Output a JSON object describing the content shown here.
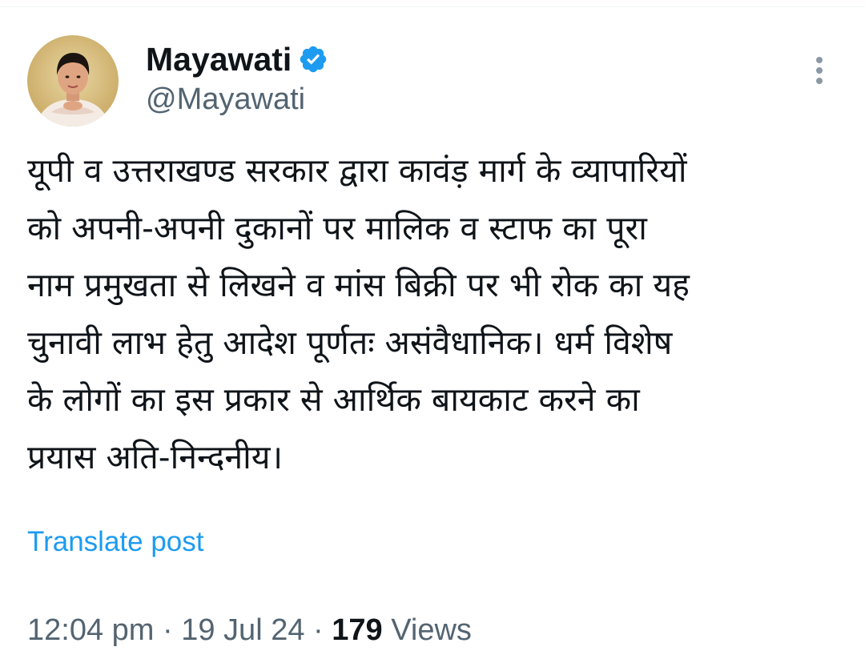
{
  "author": {
    "display_name": "Mayawati",
    "handle": "@Mayawati",
    "verified": true
  },
  "tweet": {
    "text": "यूपी व उत्तराखण्ड सरकार द्वारा कावंड़ मार्ग के व्यापारियों\nको अपनी-अपनी दुकानों पर मालिक व स्टाफ का पूरा\nनाम प्रमुखता से लिखने व मांस बिक्री पर भी रोक का यह\nचुनावी लाभ हेतु आदेश पूर्णतः असंवैधानिक। धर्म विशेष\nके लोगों का इस प्रकार से आर्थिक बायकाट करने का\nप्रयास अति-निन्दनीय।",
    "translate_label": "Translate post"
  },
  "meta": {
    "time": "12:04 pm",
    "separator": "·",
    "date": "19 Jul 24",
    "views_count": "179",
    "views_label": "Views"
  },
  "icons": {
    "verified": "verified-badge-icon",
    "more": "more-vertical-icon"
  },
  "colors": {
    "text": "#0f1419",
    "secondary": "#536471",
    "link": "#1d9bf0",
    "verified": "#1d9bf0"
  }
}
